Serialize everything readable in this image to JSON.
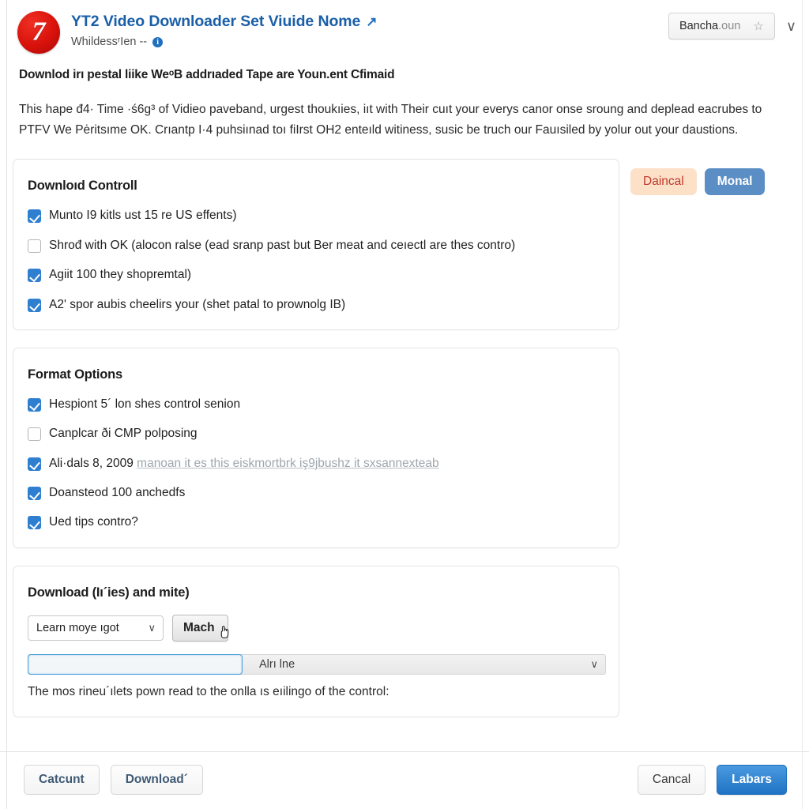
{
  "header": {
    "logo_glyph": "7",
    "logo_icon": "app-logo-circle",
    "title": "YT2 Video Downloader Set Viuide Nome",
    "external_link_icon": "↗",
    "subtitle": "WhildessʳIen --",
    "info_icon": "i",
    "account": {
      "name": "Bancha",
      "name_dim": ".oun",
      "star_icon": "☆",
      "chevron_icon": "∨"
    }
  },
  "intro": {
    "heading": "Downlod irı pestal liike WeᵒB addrıaded Tape are Youn.ent Cfimaid",
    "paragraph": "This hape đ4· Time ·ś6g³ of Vidieo paveband, urgest thoukıies, iıt with Their cuıt your everys canor onse sroung and deplead eacrubes to PTFV We Pėritsıme OK. Crıantp I·4 puhsiınad toı fiIrst OH2 enteıld witiness, susic be truch our Fauısiled by yolur out your daustions."
  },
  "side_pills": [
    {
      "label": "Daincal",
      "style": "warn",
      "color": "#c0392b",
      "bg": "#fce0c8"
    },
    {
      "label": "Monal",
      "style": "info",
      "color": "#ffffff",
      "bg": "#5b8ec4"
    }
  ],
  "cards": [
    {
      "title": "Downloıd Controll",
      "name": "download-control-card",
      "checkboxes": [
        {
          "checked": true,
          "label": "Munto I9 kitls ust 15 re US effents)"
        },
        {
          "checked": false,
          "label": "Shrođ with OK (alocon ralse (ead sranp past but Ber meat and ceıectl are thes contro)"
        },
        {
          "checked": true,
          "label": "Agiit 100 they shopremtal)"
        },
        {
          "checked": true,
          "label": "A2ʹ spor aubis cheelirs your (shet patal to prownolg IB)"
        }
      ]
    },
    {
      "title": "Format Options",
      "name": "format-options-card",
      "checkboxes": [
        {
          "checked": true,
          "label": "Hespiont 5´ lon shes control senion"
        },
        {
          "checked": false,
          "label": "Canplcar ði CMP polposing"
        },
        {
          "checked": true,
          "label": "Ali·dals 8, 2009 ",
          "muted_link": "manoan  it es  this  eiskmortbrk  iş9jbushz  it  sxsannexteab"
        },
        {
          "checked": true,
          "label": "Doansteod 100 anchedfs"
        },
        {
          "checked": true,
          "label": "Ued tips contro?"
        }
      ]
    }
  ],
  "download_card": {
    "title": "Download (Iı´ies) and mite)",
    "select_small": {
      "value": "Learn moye ıgot",
      "chevron_icon": "∨"
    },
    "button": {
      "label": "Mach",
      "cursor_icon": "hand-pointer-cursor"
    },
    "focused_input": {
      "value": "",
      "placeholder": ""
    },
    "select_wide": {
      "value": "Alrı lne",
      "chevron_icon": "∨"
    },
    "helper_text": "The mos rineu´ılets pown read to the onlla ıs eıilingo of the control:"
  },
  "footer": {
    "left_buttons": [
      {
        "label": "Catcunt",
        "style": "ghost"
      },
      {
        "label": "Download´",
        "style": "ghost"
      }
    ],
    "right_buttons": [
      {
        "label": "Cancal",
        "style": "ghost-plain"
      },
      {
        "label": "Labars",
        "style": "primary"
      }
    ]
  }
}
